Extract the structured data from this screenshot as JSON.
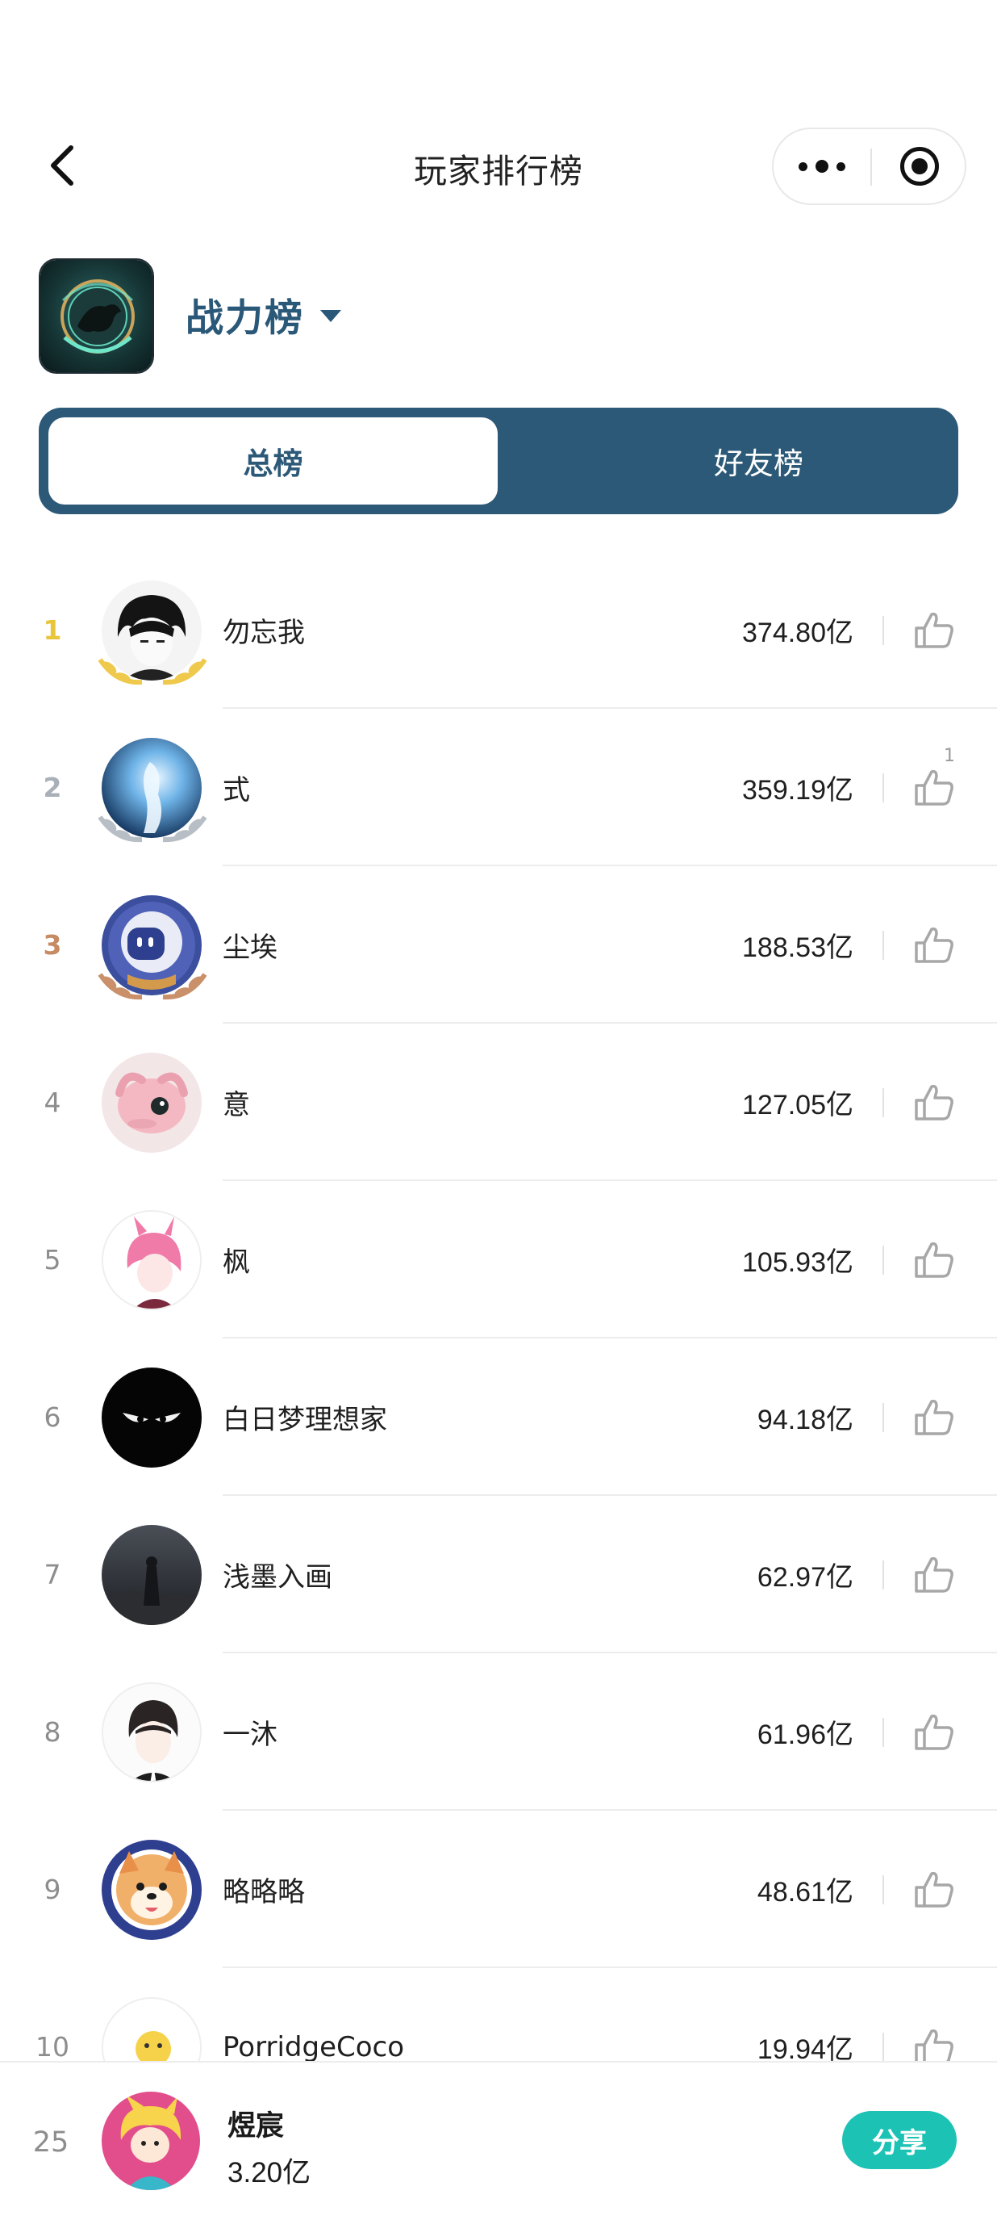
{
  "header": {
    "title": "玩家排行榜"
  },
  "board": {
    "selected": "战力榜"
  },
  "tabs": [
    {
      "label": "总榜",
      "active": true
    },
    {
      "label": "好友榜",
      "active": false
    }
  ],
  "ranking": [
    {
      "rank": "1",
      "name": "勿忘我",
      "score": "374.80亿",
      "likes": ""
    },
    {
      "rank": "2",
      "name": "式",
      "score": "359.19亿",
      "likes": "1"
    },
    {
      "rank": "3",
      "name": "尘埃",
      "score": "188.53亿",
      "likes": ""
    },
    {
      "rank": "4",
      "name": "意",
      "score": "127.05亿",
      "likes": ""
    },
    {
      "rank": "5",
      "name": "枫",
      "score": "105.93亿",
      "likes": ""
    },
    {
      "rank": "6",
      "name": "白日梦理想家",
      "score": "94.18亿",
      "likes": ""
    },
    {
      "rank": "7",
      "name": "浅墨入画",
      "score": "62.97亿",
      "likes": ""
    },
    {
      "rank": "8",
      "name": "一沐",
      "score": "61.96亿",
      "likes": ""
    },
    {
      "rank": "9",
      "name": "略略略",
      "score": "48.61亿",
      "likes": ""
    },
    {
      "rank": "10",
      "name": "PorridgeCoco",
      "score": "19.94亿",
      "likes": ""
    }
  ],
  "me": {
    "rank": "25",
    "name": "煜宸",
    "score": "3.20亿",
    "share_label": "分享"
  },
  "colors": {
    "accent": "#2c5977",
    "share": "#1cc3b5",
    "gold": "#e9c53a",
    "silver": "#a9b0b8",
    "bronze": "#c78b63"
  }
}
